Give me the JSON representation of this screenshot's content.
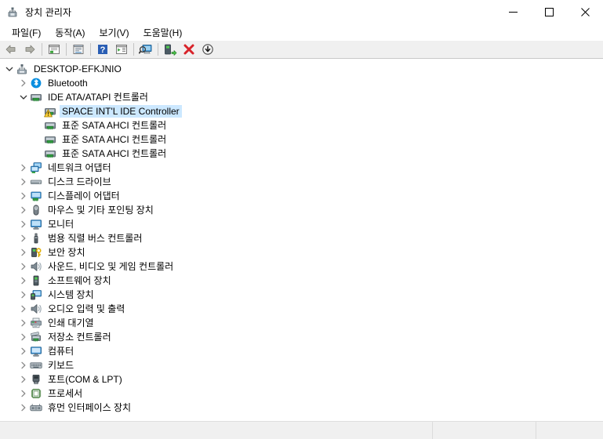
{
  "window": {
    "title": "장치 관리자",
    "icon": "device-manager-icon",
    "controls": {
      "minimize_label": "최소화",
      "maximize_label": "최대화",
      "close_label": "닫기"
    }
  },
  "menubar": {
    "items": [
      {
        "label": "파일(F)",
        "name": "menu-file"
      },
      {
        "label": "동작(A)",
        "name": "menu-action"
      },
      {
        "label": "보기(V)",
        "name": "menu-view"
      },
      {
        "label": "도움말(H)",
        "name": "menu-help"
      }
    ]
  },
  "toolbar": {
    "buttons": [
      {
        "icon": "back-arrow-icon",
        "tooltip": "뒤로"
      },
      {
        "icon": "forward-arrow-icon",
        "tooltip": "앞으로"
      },
      {
        "icon": "show-hide-console-tree-icon",
        "tooltip": "콘솔 트리 표시/숨기기"
      },
      {
        "icon": "properties-icon",
        "tooltip": "속성"
      },
      {
        "icon": "help-icon",
        "tooltip": "도움말"
      },
      {
        "icon": "view-list-icon",
        "tooltip": "보기"
      },
      {
        "icon": "scan-hardware-changes-icon",
        "tooltip": "하드웨어 변경 사항 검색"
      },
      {
        "icon": "update-driver-icon",
        "tooltip": "드라이버 업데이트"
      },
      {
        "icon": "uninstall-device-icon",
        "tooltip": "장치 제거"
      },
      {
        "icon": "disable-device-icon",
        "tooltip": "장치 사용 안 함"
      }
    ]
  },
  "tree": {
    "nodes": [
      {
        "label": "DESKTOP-EFKJNIO",
        "indent": 0,
        "twisty": "expanded",
        "icon": "computer-root-icon",
        "selected": false,
        "warning": false
      },
      {
        "label": "Bluetooth",
        "indent": 1,
        "twisty": "collapsed",
        "icon": "bluetooth-icon",
        "selected": false,
        "warning": false
      },
      {
        "label": "IDE ATA/ATAPI 컨트롤러",
        "indent": 1,
        "twisty": "expanded",
        "icon": "ide-controller-icon",
        "selected": false,
        "warning": false
      },
      {
        "label": "SPACE INT'L IDE Controller",
        "indent": 2,
        "twisty": "none",
        "icon": "ide-controller-icon",
        "selected": true,
        "warning": true
      },
      {
        "label": "표준 SATA AHCI 컨트롤러",
        "indent": 2,
        "twisty": "none",
        "icon": "ide-controller-icon",
        "selected": false,
        "warning": false
      },
      {
        "label": "표준 SATA AHCI 컨트롤러",
        "indent": 2,
        "twisty": "none",
        "icon": "ide-controller-icon",
        "selected": false,
        "warning": false
      },
      {
        "label": "표준 SATA AHCI 컨트롤러",
        "indent": 2,
        "twisty": "none",
        "icon": "ide-controller-icon",
        "selected": false,
        "warning": false
      },
      {
        "label": "네트워크 어댑터",
        "indent": 1,
        "twisty": "collapsed",
        "icon": "network-adapter-icon",
        "selected": false,
        "warning": false
      },
      {
        "label": "디스크 드라이브",
        "indent": 1,
        "twisty": "collapsed",
        "icon": "disk-drive-icon",
        "selected": false,
        "warning": false
      },
      {
        "label": "디스플레이 어댑터",
        "indent": 1,
        "twisty": "collapsed",
        "icon": "display-adapter-icon",
        "selected": false,
        "warning": false
      },
      {
        "label": "마우스 및 기타 포인팅 장치",
        "indent": 1,
        "twisty": "collapsed",
        "icon": "mouse-icon",
        "selected": false,
        "warning": false
      },
      {
        "label": "모니터",
        "indent": 1,
        "twisty": "collapsed",
        "icon": "monitor-icon",
        "selected": false,
        "warning": false
      },
      {
        "label": "범용 직렬 버스 컨트롤러",
        "indent": 1,
        "twisty": "collapsed",
        "icon": "usb-controller-icon",
        "selected": false,
        "warning": false
      },
      {
        "label": "보안 장치",
        "indent": 1,
        "twisty": "collapsed",
        "icon": "security-device-icon",
        "selected": false,
        "warning": false
      },
      {
        "label": "사운드, 비디오 및 게임 컨트롤러",
        "indent": 1,
        "twisty": "collapsed",
        "icon": "sound-device-icon",
        "selected": false,
        "warning": false
      },
      {
        "label": "소프트웨어 장치",
        "indent": 1,
        "twisty": "collapsed",
        "icon": "software-device-icon",
        "selected": false,
        "warning": false
      },
      {
        "label": "시스템 장치",
        "indent": 1,
        "twisty": "collapsed",
        "icon": "system-device-icon",
        "selected": false,
        "warning": false
      },
      {
        "label": "오디오 입력 및 출력",
        "indent": 1,
        "twisty": "collapsed",
        "icon": "audio-io-icon",
        "selected": false,
        "warning": false
      },
      {
        "label": "인쇄 대기열",
        "indent": 1,
        "twisty": "collapsed",
        "icon": "print-queue-icon",
        "selected": false,
        "warning": false
      },
      {
        "label": "저장소 컨트롤러",
        "indent": 1,
        "twisty": "collapsed",
        "icon": "storage-controller-icon",
        "selected": false,
        "warning": false
      },
      {
        "label": "컴퓨터",
        "indent": 1,
        "twisty": "collapsed",
        "icon": "computer-icon",
        "selected": false,
        "warning": false
      },
      {
        "label": "키보드",
        "indent": 1,
        "twisty": "collapsed",
        "icon": "keyboard-icon",
        "selected": false,
        "warning": false
      },
      {
        "label": "포트(COM & LPT)",
        "indent": 1,
        "twisty": "collapsed",
        "icon": "port-icon",
        "selected": false,
        "warning": false
      },
      {
        "label": "프로세서",
        "indent": 1,
        "twisty": "collapsed",
        "icon": "processor-icon",
        "selected": false,
        "warning": false
      },
      {
        "label": "휴먼 인터페이스 장치",
        "indent": 1,
        "twisty": "collapsed",
        "icon": "hid-icon",
        "selected": false,
        "warning": false
      }
    ]
  },
  "statusbar": {
    "pane1": "",
    "pane2": "",
    "pane3": ""
  },
  "colors": {
    "selection": "#cce8ff",
    "toolbar_bg": "#f0f0f0",
    "statusbar_bg": "#f0f0f0",
    "warning": "#ffd23b",
    "bluetooth": "#0a8fe0",
    "close_hover": "#e81123"
  }
}
